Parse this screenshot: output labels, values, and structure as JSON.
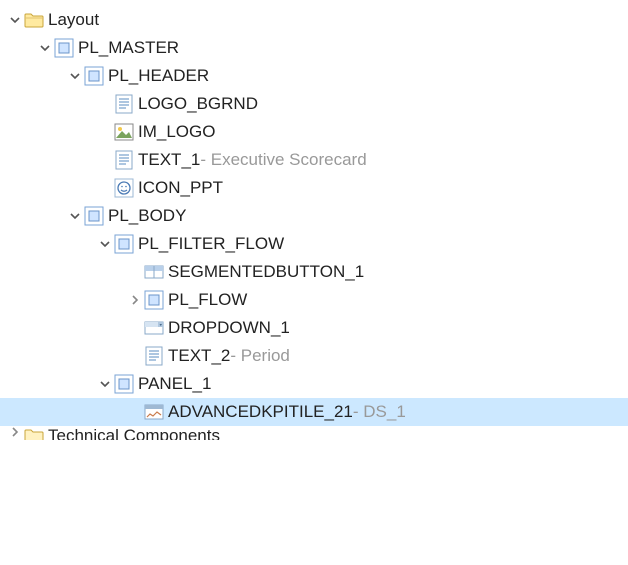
{
  "tree": [
    {
      "id": "layout",
      "depth": 0,
      "expanded": true,
      "hasChildren": true,
      "icon": "folder",
      "label": "Layout"
    },
    {
      "id": "pl_master",
      "depth": 1,
      "expanded": true,
      "hasChildren": true,
      "icon": "panel",
      "label": "PL_MASTER"
    },
    {
      "id": "pl_header",
      "depth": 2,
      "expanded": true,
      "hasChildren": true,
      "icon": "panel",
      "label": "PL_HEADER"
    },
    {
      "id": "logo_bgrnd",
      "depth": 3,
      "expanded": false,
      "hasChildren": false,
      "icon": "text",
      "label": "LOGO_BGRND"
    },
    {
      "id": "im_logo",
      "depth": 3,
      "expanded": false,
      "hasChildren": false,
      "icon": "image",
      "label": "IM_LOGO"
    },
    {
      "id": "text_1",
      "depth": 3,
      "expanded": false,
      "hasChildren": false,
      "icon": "text",
      "label": "TEXT_1",
      "suffix": " - Executive Scorecard"
    },
    {
      "id": "icon_ppt",
      "depth": 3,
      "expanded": false,
      "hasChildren": false,
      "icon": "smiley",
      "label": "ICON_PPT"
    },
    {
      "id": "pl_body",
      "depth": 2,
      "expanded": true,
      "hasChildren": true,
      "icon": "panel",
      "label": "PL_BODY"
    },
    {
      "id": "pl_filter",
      "depth": 3,
      "expanded": true,
      "hasChildren": true,
      "icon": "panel",
      "label": "PL_FILTER_FLOW"
    },
    {
      "id": "segbtn_1",
      "depth": 4,
      "expanded": false,
      "hasChildren": false,
      "icon": "segbtn",
      "label": "SEGMENTEDBUTTON_1"
    },
    {
      "id": "pl_flow",
      "depth": 4,
      "expanded": false,
      "hasChildren": true,
      "icon": "panel",
      "label": "PL_FLOW"
    },
    {
      "id": "dropdown_1",
      "depth": 4,
      "expanded": false,
      "hasChildren": false,
      "icon": "dropdown",
      "label": "DROPDOWN_1"
    },
    {
      "id": "text_2",
      "depth": 4,
      "expanded": false,
      "hasChildren": false,
      "icon": "text",
      "label": "TEXT_2",
      "suffix": " - Period"
    },
    {
      "id": "panel_1",
      "depth": 3,
      "expanded": true,
      "hasChildren": true,
      "icon": "panel",
      "label": "PANEL_1"
    },
    {
      "id": "kpitile",
      "depth": 4,
      "expanded": false,
      "hasChildren": false,
      "icon": "tile",
      "label": "ADVANCEDKPITILE_21",
      "suffix": " - DS_1",
      "selected": true
    },
    {
      "id": "tech",
      "depth": 0,
      "expanded": false,
      "hasChildren": true,
      "icon": "folder-closed",
      "label": "Technical Components",
      "cut": true
    }
  ],
  "indentUnit": 30,
  "baseIndent": 6
}
